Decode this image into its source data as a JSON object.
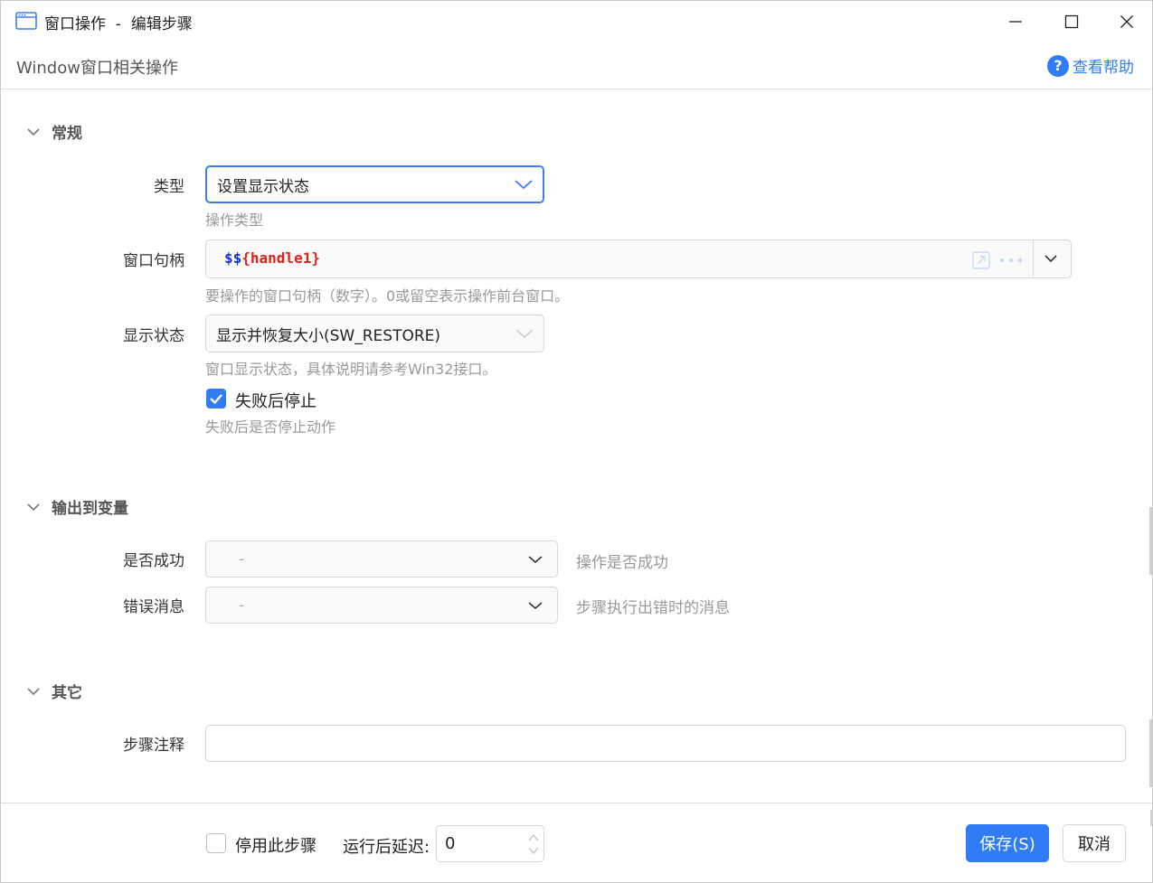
{
  "window": {
    "title": "窗口操作  -  编辑步骤",
    "subtitle": "Window窗口相关操作",
    "help_label": "查看帮助"
  },
  "sections": {
    "general": {
      "title": "常规",
      "type_label": "类型",
      "type_value": "设置显示状态",
      "type_hint": "操作类型",
      "handle_label": "窗口句柄",
      "handle_prefix": "$$",
      "handle_var": "{handle1}",
      "handle_hint": "要操作的窗口句柄（数字）。0或留空表示操作前台窗口。",
      "show_state_label": "显示状态",
      "show_state_value": "显示并恢复大小(SW_RESTORE)",
      "show_state_hint": "窗口显示状态，具体说明请参考Win32接口。",
      "stop_on_fail_label": "失败后停止",
      "stop_on_fail_checked": true,
      "stop_on_fail_hint": "失败后是否停止动作"
    },
    "output": {
      "title": "输出到变量",
      "success_label": "是否成功",
      "success_value": "-",
      "success_hint": "操作是否成功",
      "error_label": "错误消息",
      "error_value": "-",
      "error_hint": "步骤执行出错时的消息"
    },
    "other": {
      "title": "其它",
      "comment_label": "步骤注释",
      "comment_value": ""
    }
  },
  "footer": {
    "disable_label": "停用此步骤",
    "disable_checked": false,
    "delay_label": "运行后延迟:",
    "delay_value": "0",
    "save_label": "保存(S)",
    "cancel_label": "取消"
  },
  "colors": {
    "accent": "#2f7cf6",
    "variable_dollar": "#1a2fd6",
    "variable_name": "#e0211c"
  }
}
